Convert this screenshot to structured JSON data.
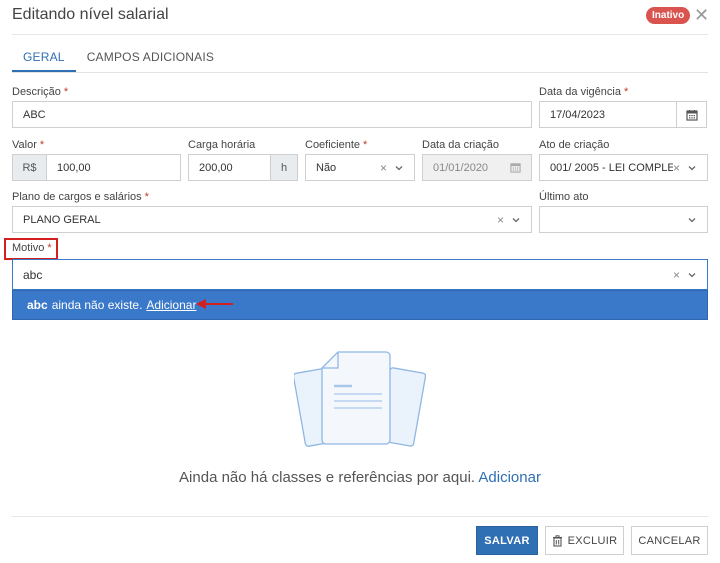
{
  "dialog": {
    "title": "Editando nível salarial",
    "status_badge": "Inativo",
    "close_glyph": "✕"
  },
  "tabs": [
    {
      "label": "GERAL",
      "active": true
    },
    {
      "label": "CAMPOS ADICIONAIS",
      "active": false
    }
  ],
  "form": {
    "descricao": {
      "label": "Descrição",
      "value": "ABC"
    },
    "data_vigencia": {
      "label": "Data da vigência",
      "value": "17/04/2023"
    },
    "valor": {
      "label": "Valor",
      "prefix": "R$",
      "value": "100,00"
    },
    "carga_horaria": {
      "label": "Carga horária",
      "value": "200,00",
      "suffix": "h"
    },
    "coeficiente": {
      "label": "Coeficiente",
      "value": "Não"
    },
    "data_criacao": {
      "label": "Data da criação",
      "value": "01/01/2020"
    },
    "ato_criacao": {
      "label": "Ato de criação",
      "value": "001/ 2005 - LEI COMPLE..."
    },
    "plano_cargos": {
      "label": "Plano de cargos e salários",
      "value": "PLANO GERAL"
    },
    "ultimo_ato": {
      "label": "Último ato",
      "value": ""
    },
    "motivo": {
      "label": "Motivo",
      "value": "abc"
    }
  },
  "dropdown": {
    "term": "abc",
    "message": "ainda não existe.",
    "action": "Adicionar"
  },
  "empty_state": {
    "text": "Ainda não há classes e referências por aqui.",
    "action": "Adicionar"
  },
  "footer": {
    "save": "SALVAR",
    "delete": "EXCLUIR",
    "cancel": "CANCELAR"
  },
  "required_mark": "*",
  "clear_glyph": "×",
  "colors": {
    "accent": "#2f6fb3",
    "badge": "#d9534f",
    "highlight": "#d21f1f",
    "dropdown": "#3a78c9"
  },
  "icons": [
    "calendar-icon",
    "chevron-down-icon",
    "clear-icon",
    "trash-icon",
    "document-illustration",
    "red-arrow"
  ]
}
